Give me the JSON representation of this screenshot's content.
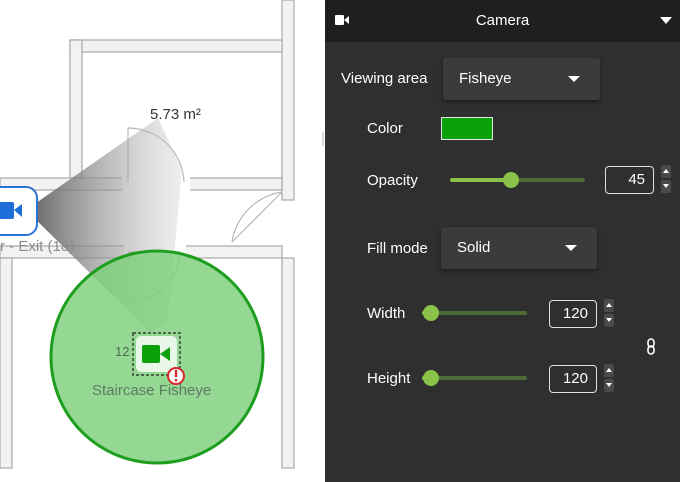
{
  "floor_plan": {
    "room_area_label": "5.73 m²",
    "door_label": "r - Exit (18)",
    "camera_number": "12",
    "camera_name": "Staircase Fisheye",
    "coverage_color": "#7ccf7c",
    "coverage_stroke": "#1e9e1e",
    "camera_icon_color": "#0aa10a",
    "warning_color": "#d62828",
    "selected_camera_icon": "video-camera-icon",
    "other_camera_icon": "video-camera-icon",
    "warning_icon": "exclamation-icon"
  },
  "panel": {
    "title": "Camera",
    "header_icon": "video-camera-icon",
    "collapse_icon": "chevron-down-icon",
    "link_icon": "chain-link-icon",
    "viewing_area": {
      "label": "Viewing area",
      "value": "Fisheye"
    },
    "color": {
      "label": "Color",
      "value": "#0aa10a"
    },
    "opacity": {
      "label": "Opacity",
      "value": "45",
      "fraction": 0.45
    },
    "fill_mode": {
      "label": "Fill mode",
      "value": "Solid"
    },
    "width": {
      "label": "Width",
      "value": "120",
      "fraction": 0.09
    },
    "height": {
      "label": "Height",
      "value": "120",
      "fraction": 0.09
    },
    "accent_color": "#8bc34a"
  }
}
